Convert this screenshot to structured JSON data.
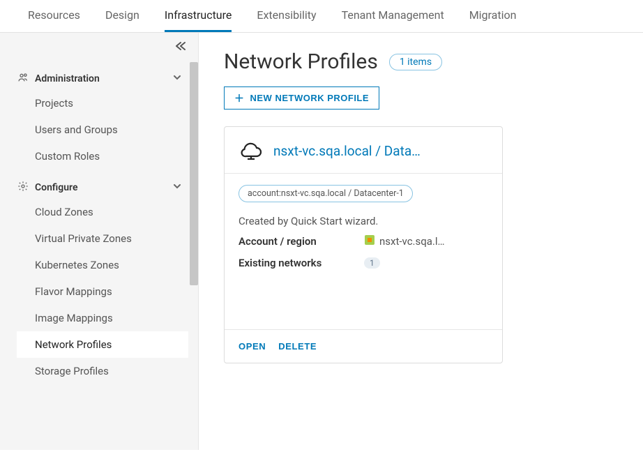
{
  "topTabs": {
    "items": [
      {
        "label": "Resources"
      },
      {
        "label": "Design"
      },
      {
        "label": "Infrastructure",
        "active": true
      },
      {
        "label": "Extensibility"
      },
      {
        "label": "Tenant Management"
      },
      {
        "label": "Migration"
      }
    ]
  },
  "sidebar": {
    "sections": [
      {
        "icon": "users",
        "label": "Administration",
        "items": [
          {
            "label": "Projects"
          },
          {
            "label": "Users and Groups"
          },
          {
            "label": "Custom Roles"
          }
        ]
      },
      {
        "icon": "gear",
        "label": "Configure",
        "items": [
          {
            "label": "Cloud Zones"
          },
          {
            "label": "Virtual Private Zones"
          },
          {
            "label": "Kubernetes Zones"
          },
          {
            "label": "Flavor Mappings"
          },
          {
            "label": "Image Mappings"
          },
          {
            "label": "Network Profiles",
            "selected": true
          },
          {
            "label": "Storage Profiles"
          }
        ]
      }
    ]
  },
  "main": {
    "title": "Network Profiles",
    "itemsPill": "1 items",
    "newButton": "NEW NETWORK PROFILE",
    "card": {
      "title": "nsxt-vc.sqa.local / Data…",
      "tag": "account:nsxt-vc.sqa.local / Datacenter-1",
      "description": "Created by Quick Start wizard.",
      "accountRegionLabel": "Account / region",
      "accountRegionValue": "nsxt-vc.sqa.l…",
      "existingNetworksLabel": "Existing networks",
      "existingNetworksCount": "1",
      "openLabel": "OPEN",
      "deleteLabel": "DELETE"
    }
  }
}
